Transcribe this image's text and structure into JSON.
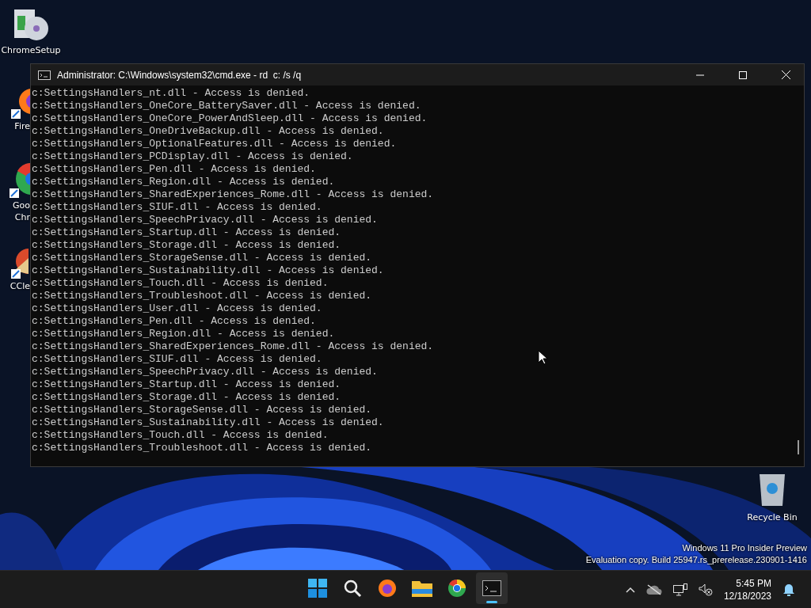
{
  "desktop_icons": [
    {
      "kind": "installer",
      "label": "ChromeSetup"
    },
    {
      "kind": "firefox",
      "label": "Fire"
    },
    {
      "kind": "chrome",
      "label": "Goo\nChr"
    },
    {
      "kind": "ccleaner",
      "label": "CCle"
    }
  ],
  "window": {
    "title": "Administrator: C:\\Windows\\system32\\cmd.exe - rd  c: /s /q",
    "lines": [
      "c:SettingsHandlers_nt.dll - Access is denied.",
      "c:SettingsHandlers_OneCore_BatterySaver.dll - Access is denied.",
      "c:SettingsHandlers_OneCore_PowerAndSleep.dll - Access is denied.",
      "c:SettingsHandlers_OneDriveBackup.dll - Access is denied.",
      "c:SettingsHandlers_OptionalFeatures.dll - Access is denied.",
      "c:SettingsHandlers_PCDisplay.dll - Access is denied.",
      "c:SettingsHandlers_Pen.dll - Access is denied.",
      "c:SettingsHandlers_Region.dll - Access is denied.",
      "c:SettingsHandlers_SharedExperiences_Rome.dll - Access is denied.",
      "c:SettingsHandlers_SIUF.dll - Access is denied.",
      "c:SettingsHandlers_SpeechPrivacy.dll - Access is denied.",
      "c:SettingsHandlers_Startup.dll - Access is denied.",
      "c:SettingsHandlers_Storage.dll - Access is denied.",
      "c:SettingsHandlers_StorageSense.dll - Access is denied.",
      "c:SettingsHandlers_Sustainability.dll - Access is denied.",
      "c:SettingsHandlers_Touch.dll - Access is denied.",
      "c:SettingsHandlers_Troubleshoot.dll - Access is denied.",
      "c:SettingsHandlers_User.dll - Access is denied.",
      "c:SettingsHandlers_Pen.dll - Access is denied.",
      "c:SettingsHandlers_Region.dll - Access is denied.",
      "c:SettingsHandlers_SharedExperiences_Rome.dll - Access is denied.",
      "c:SettingsHandlers_SIUF.dll - Access is denied.",
      "c:SettingsHandlers_SpeechPrivacy.dll - Access is denied.",
      "c:SettingsHandlers_Startup.dll - Access is denied.",
      "c:SettingsHandlers_Storage.dll - Access is denied.",
      "c:SettingsHandlers_StorageSense.dll - Access is denied.",
      "c:SettingsHandlers_Sustainability.dll - Access is denied.",
      "c:SettingsHandlers_Touch.dll - Access is denied.",
      "c:SettingsHandlers_Troubleshoot.dll - Access is denied."
    ]
  },
  "recycle_bin": {
    "label": "Recycle Bin"
  },
  "os_notice": [
    "Windows 11 Pro Insider Preview",
    "Evaluation copy. Build 25947.rs_prerelease.230901-1416"
  ],
  "taskbar": {
    "apps": [
      {
        "kind": "start",
        "selected": false
      },
      {
        "kind": "search",
        "selected": false
      },
      {
        "kind": "firefox",
        "selected": false
      },
      {
        "kind": "explorer",
        "selected": false
      },
      {
        "kind": "chrome",
        "selected": false
      },
      {
        "kind": "terminal",
        "selected": true
      }
    ],
    "time": "5:45 PM",
    "date": "12/18/2023"
  }
}
